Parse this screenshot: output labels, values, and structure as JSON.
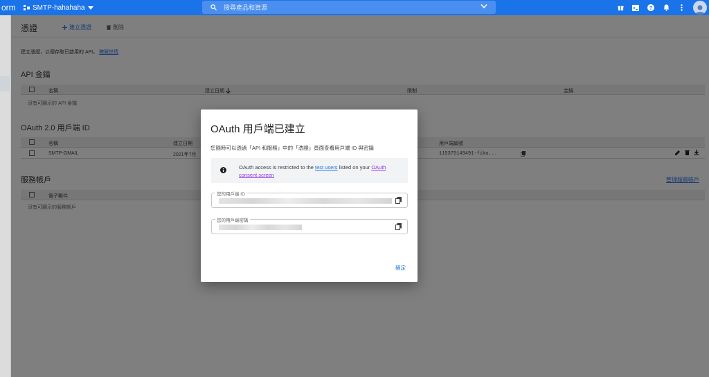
{
  "topbar": {
    "brand_fragment": "orm",
    "project_name": "SMTP-hahahaha",
    "search_placeholder": "搜尋產品和資源"
  },
  "page": {
    "title": "憑證",
    "create_label": "建立憑證",
    "delete_label": "刪除",
    "description": "建立憑證，以便存取已啟用的 API。",
    "learn_more": "瞭解詳情"
  },
  "api_keys": {
    "section_title": "API 金鑰",
    "columns": [
      "名稱",
      "建立日期",
      "限制",
      "金鑰"
    ],
    "empty_text": "沒有可顯示的 API 金鑰"
  },
  "oauth_clients": {
    "section_title": "OAuth 2.0 用戶端 ID",
    "columns": [
      "名稱",
      "建立日期",
      "用戶端編號"
    ],
    "row": {
      "name": "SMTP-GMAIL",
      "date": "2021年7月",
      "client_id": "115375149491-fiko..."
    }
  },
  "service_accounts": {
    "section_title": "服務帳戶",
    "manage_link": "管理服務帳戶",
    "columns": [
      "電子郵件"
    ],
    "empty_text": "沒有可顯示的服務帳戶"
  },
  "dialog": {
    "title": "OAuth 用戶端已建立",
    "description": "您隨時可以透過「API 和服務」中的「憑證」頁面查看用戶端 ID 與密鑰",
    "notice_prefix": "OAuth access is restricted to the ",
    "notice_link1": "test users",
    "notice_middle": " listed on your ",
    "notice_link2": "OAuth consent screen",
    "client_id_label": "您的用戶端 ID",
    "client_secret_label": "您的用戶端密碼",
    "ok_label": "確定"
  },
  "colors": {
    "brand_blue": "#1a73e8",
    "link_purple": "#9334e6"
  }
}
